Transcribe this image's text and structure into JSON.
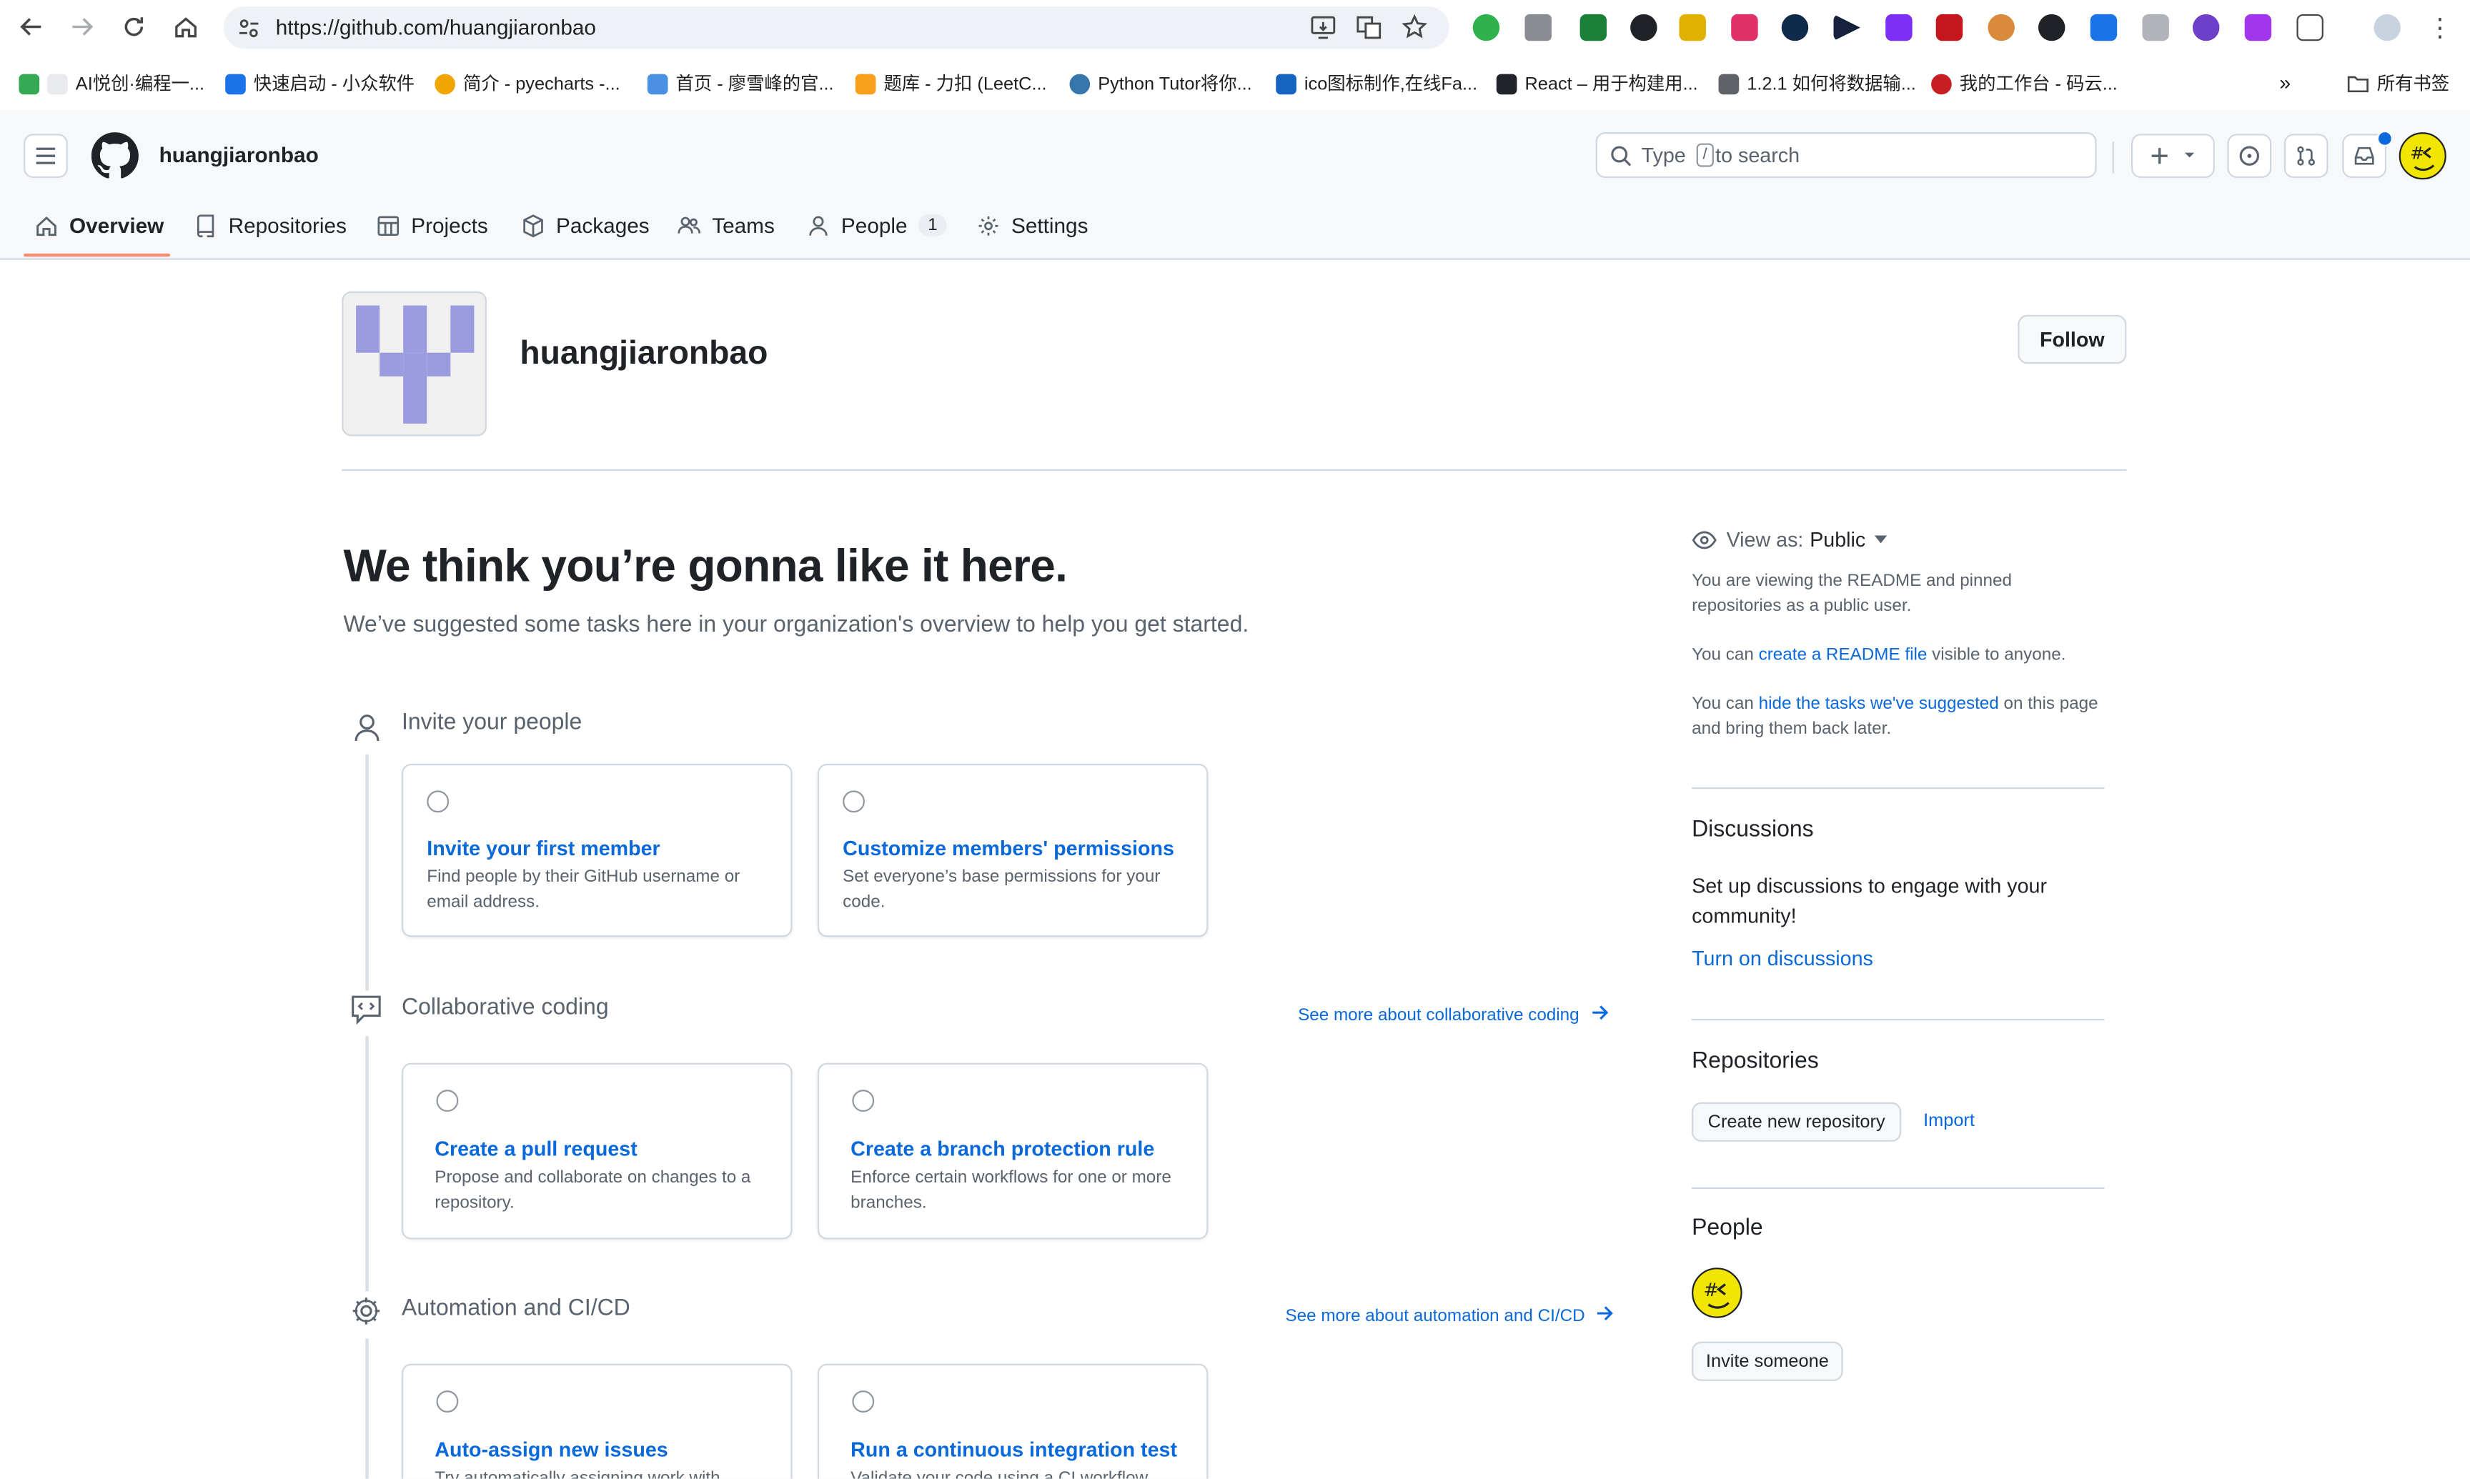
{
  "browser": {
    "url": "https://github.com/huangjiaronbao",
    "bookmarks": [
      "AI悦创·编程一...",
      "快速启动 - 小众软件",
      "简介 - pyecharts -...",
      "首页 - 廖雪峰的官...",
      "题库 - 力扣 (LeetC...",
      "Python Tutor将你...",
      "ico图标制作,在线Fa...",
      "React – 用于构建用...",
      "1.2.1 如何将数据输...",
      "我的工作台 - 码云..."
    ],
    "all_bookmarks": "所有书签"
  },
  "header": {
    "org_name": "huangjiaronbao",
    "search_prefix": "Type",
    "search_key": "/",
    "search_suffix": "to search"
  },
  "tabs": [
    {
      "label": "Overview",
      "icon": "home-icon"
    },
    {
      "label": "Repositories",
      "icon": "repo-icon"
    },
    {
      "label": "Projects",
      "icon": "table-icon"
    },
    {
      "label": "Packages",
      "icon": "package-icon"
    },
    {
      "label": "Teams",
      "icon": "people-icon"
    },
    {
      "label": "People",
      "icon": "person-icon",
      "count": "1"
    },
    {
      "label": "Settings",
      "icon": "gear-icon"
    }
  ],
  "profile": {
    "name": "huangjiaronbao",
    "follow_label": "Follow"
  },
  "main": {
    "headline": "We think you’re gonna like it here.",
    "subheadline": "We’ve suggested some tasks here in your organization's overview to help you get started.",
    "sections": [
      {
        "title": "Invite your people",
        "see_more": "",
        "cards": [
          {
            "title": "Invite your first member",
            "desc": "Find people by their GitHub username or email address."
          },
          {
            "title": "Customize members' permissions",
            "desc": "Set everyone’s base permissions for your code."
          }
        ]
      },
      {
        "title": "Collaborative coding",
        "see_more": "See more about collaborative coding",
        "cards": [
          {
            "title": "Create a pull request",
            "desc": "Propose and collaborate on changes to a repository."
          },
          {
            "title": "Create a branch protection rule",
            "desc": "Enforce certain workflows for one or more branches."
          }
        ]
      },
      {
        "title": "Automation and CI/CD",
        "see_more": "See more about automation and CI/CD",
        "cards": [
          {
            "title": "Auto-assign new issues",
            "desc": "Try automatically assigning work with"
          },
          {
            "title": "Run a continuous integration test",
            "desc": "Validate your code using a CI workflow"
          }
        ]
      }
    ]
  },
  "sidebar": {
    "view_as_label": "View as:",
    "view_as_value": "Public",
    "p1": "You are viewing the README and pinned repositories as a public user.",
    "p2_pre": "You can",
    "p2_link": "create a README file",
    "p2_post": "visible to anyone.",
    "p3_pre": "You can",
    "p3_link": "hide the tasks we've suggested",
    "p3_post": "on this page and bring them back later.",
    "discussions_title": "Discussions",
    "discussions_text": "Set up discussions to engage with your community!",
    "discussions_link": "Turn on discussions",
    "repos_title": "Repositories",
    "create_repo": "Create new repository",
    "import": "Import",
    "people_title": "People",
    "invite": "Invite someone"
  },
  "colors": {
    "link": "#0969da",
    "tab_underline": "#fd8c73",
    "identicon": "#9b9be0",
    "avatar": "#f2e600"
  }
}
